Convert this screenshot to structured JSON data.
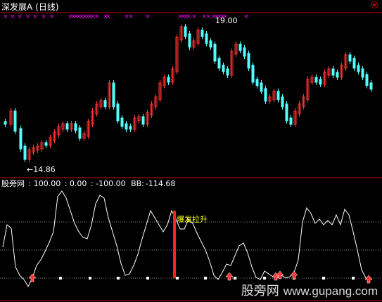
{
  "window": {
    "stock_name": "深发展A",
    "period": "(日线)"
  },
  "price_panel": {
    "high_label": "19.00",
    "low_label": "←14.86",
    "colors": {
      "up": "#ff3232",
      "down": "#54ffff",
      "marker": "#ff00ff",
      "frame": "#c00000"
    },
    "marker_symbol": "×",
    "top_markers_x": [
      8,
      18,
      28,
      40,
      50,
      62,
      74,
      100,
      104,
      108,
      112,
      116,
      120,
      124,
      128,
      132,
      138,
      150,
      154,
      180,
      186,
      210,
      256,
      260,
      264,
      268,
      276,
      290,
      296,
      304,
      308,
      312,
      316,
      320,
      350
    ]
  },
  "indicator_panel": {
    "name": "股旁网",
    "values": [
      ": 100.00",
      ": 0.00",
      ": -100.00"
    ],
    "bb_label": "BB:",
    "bb_value": "-114.68",
    "burst_label": "爆发拉升",
    "line_color": "#ffffff",
    "bar_color": "#ff2020",
    "level_line_color": "#8a8a8a"
  },
  "watermark": {
    "cn": "股旁网",
    "url": "www.gupang.com"
  }
}
